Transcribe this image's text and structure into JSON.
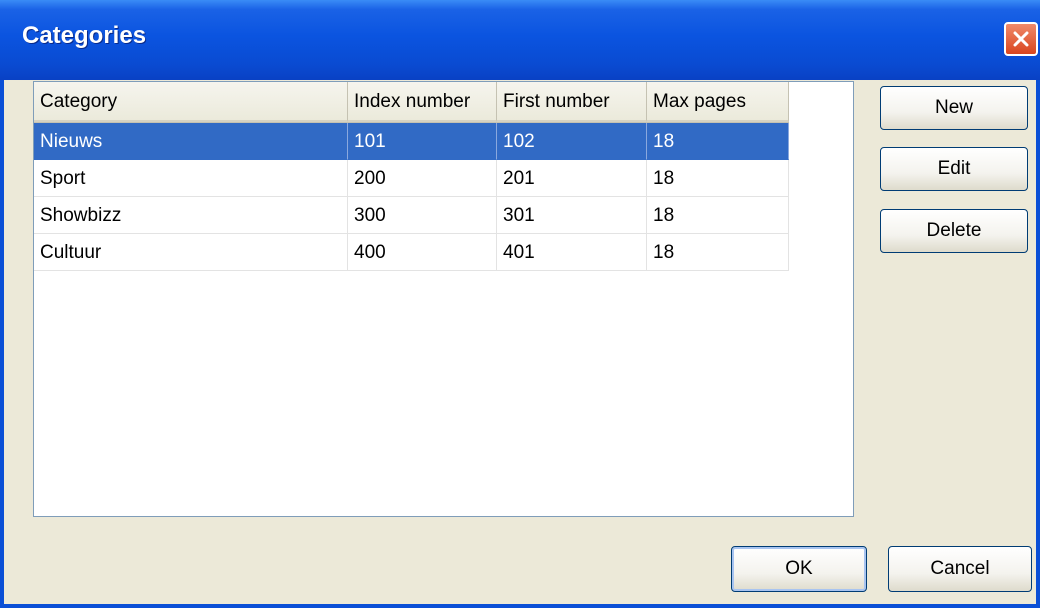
{
  "window": {
    "title": "Categories"
  },
  "table": {
    "columns": [
      {
        "label": "Category"
      },
      {
        "label": "Index number"
      },
      {
        "label": "First number"
      },
      {
        "label": "Max pages"
      }
    ],
    "rows": [
      {
        "cells": [
          "Nieuws",
          "101",
          "102",
          "18"
        ],
        "selected": true
      },
      {
        "cells": [
          "Sport",
          "200",
          "201",
          "18"
        ],
        "selected": false
      },
      {
        "cells": [
          "Showbizz",
          "300",
          "301",
          "18"
        ],
        "selected": false
      },
      {
        "cells": [
          "Cultuur",
          "400",
          "401",
          "18"
        ],
        "selected": false
      }
    ]
  },
  "buttons": {
    "new_label": "New",
    "edit_label": "Edit",
    "delete_label": "Delete",
    "ok_label": "OK",
    "cancel_label": "Cancel"
  },
  "icons": {
    "close": "close-icon"
  },
  "colors": {
    "title_bar": "#0a4fd6",
    "selection": "#316ac5",
    "close_button": "#d9451f",
    "background": "#ece9d8"
  }
}
